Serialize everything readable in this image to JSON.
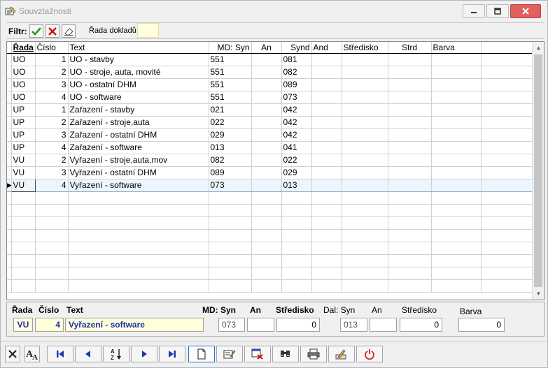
{
  "window": {
    "title": "Souvztažnosti"
  },
  "filter": {
    "label": "Filtr:",
    "series_label": "Řada dokladů",
    "series_value": ""
  },
  "grid": {
    "columns": [
      "Řada",
      "Číslo",
      "Text",
      "MD: Syn",
      "An",
      "Synd",
      "And",
      "Středisko",
      "Strd",
      "Barva"
    ],
    "rows": [
      [
        "UO",
        "1",
        " UO - stavby",
        "551",
        "",
        "081",
        "",
        "",
        "",
        ""
      ],
      [
        "UO",
        "2",
        "UO - stroje, auta, movité",
        "551",
        "",
        "082",
        "",
        "",
        "",
        ""
      ],
      [
        "UO",
        "3",
        "UO - ostatní DHM",
        "551",
        "",
        "089",
        "",
        "",
        "",
        ""
      ],
      [
        "UO",
        "4",
        "UO - software",
        "551",
        "",
        "073",
        "",
        "",
        "",
        ""
      ],
      [
        "UP",
        "1",
        "Zařazení - stavby",
        "021",
        "",
        "042",
        "",
        "",
        "",
        ""
      ],
      [
        "UP",
        "2",
        "Zařazení - stroje,auta",
        "022",
        "",
        "042",
        "",
        "",
        "",
        ""
      ],
      [
        "UP",
        "3",
        "Zařazení - ostatní DHM",
        "029",
        "",
        "042",
        "",
        "",
        "",
        ""
      ],
      [
        "UP",
        "4",
        "Zařazení - software",
        "013",
        "",
        "041",
        "",
        "",
        "",
        ""
      ],
      [
        "VU",
        "2",
        "Vyřazení - stroje,auta,mov",
        "082",
        "",
        "022",
        "",
        "",
        "",
        ""
      ],
      [
        "VU",
        "3",
        "Vyřazení - ostatní DHM",
        "089",
        "",
        "029",
        "",
        "",
        "",
        ""
      ],
      [
        "VU",
        "4",
        "Vyřazení - software",
        "073",
        "",
        "013",
        "",
        "",
        "",
        ""
      ]
    ],
    "selected_index": 10
  },
  "detail": {
    "labels": {
      "rada": "Řada",
      "cislo": "Číslo",
      "text": "Text",
      "md_syn": "MD: Syn",
      "md_an": "An",
      "md_stredisko": "Středisko",
      "dal_syn": "Dal: Syn",
      "dal_an": "An",
      "dal_stredisko": "Středisko",
      "barva": "Barva"
    },
    "values": {
      "rada": "VU",
      "cislo": "4",
      "text": "Vyřazení - software",
      "md_syn": "073",
      "md_an": "",
      "md_stredisko": "0",
      "dal_syn": "013",
      "dal_an": "",
      "dal_stredisko": "0",
      "barva": "0"
    }
  },
  "toolbar": {
    "buttons": [
      "close-icon",
      "font-icon",
      "first-record-icon",
      "previous-record-icon",
      "sort-icon",
      "next-record-icon",
      "last-record-icon",
      "new-document-icon",
      "edit-icon",
      "delete-icon",
      "find-icon",
      "print-icon",
      "tools-icon",
      "power-icon"
    ]
  },
  "colors": {
    "selection": "#eef6fd",
    "input_yellow": "#ffffd9",
    "accent_blue": "#1c2fb0",
    "power_red": "#d42020"
  }
}
